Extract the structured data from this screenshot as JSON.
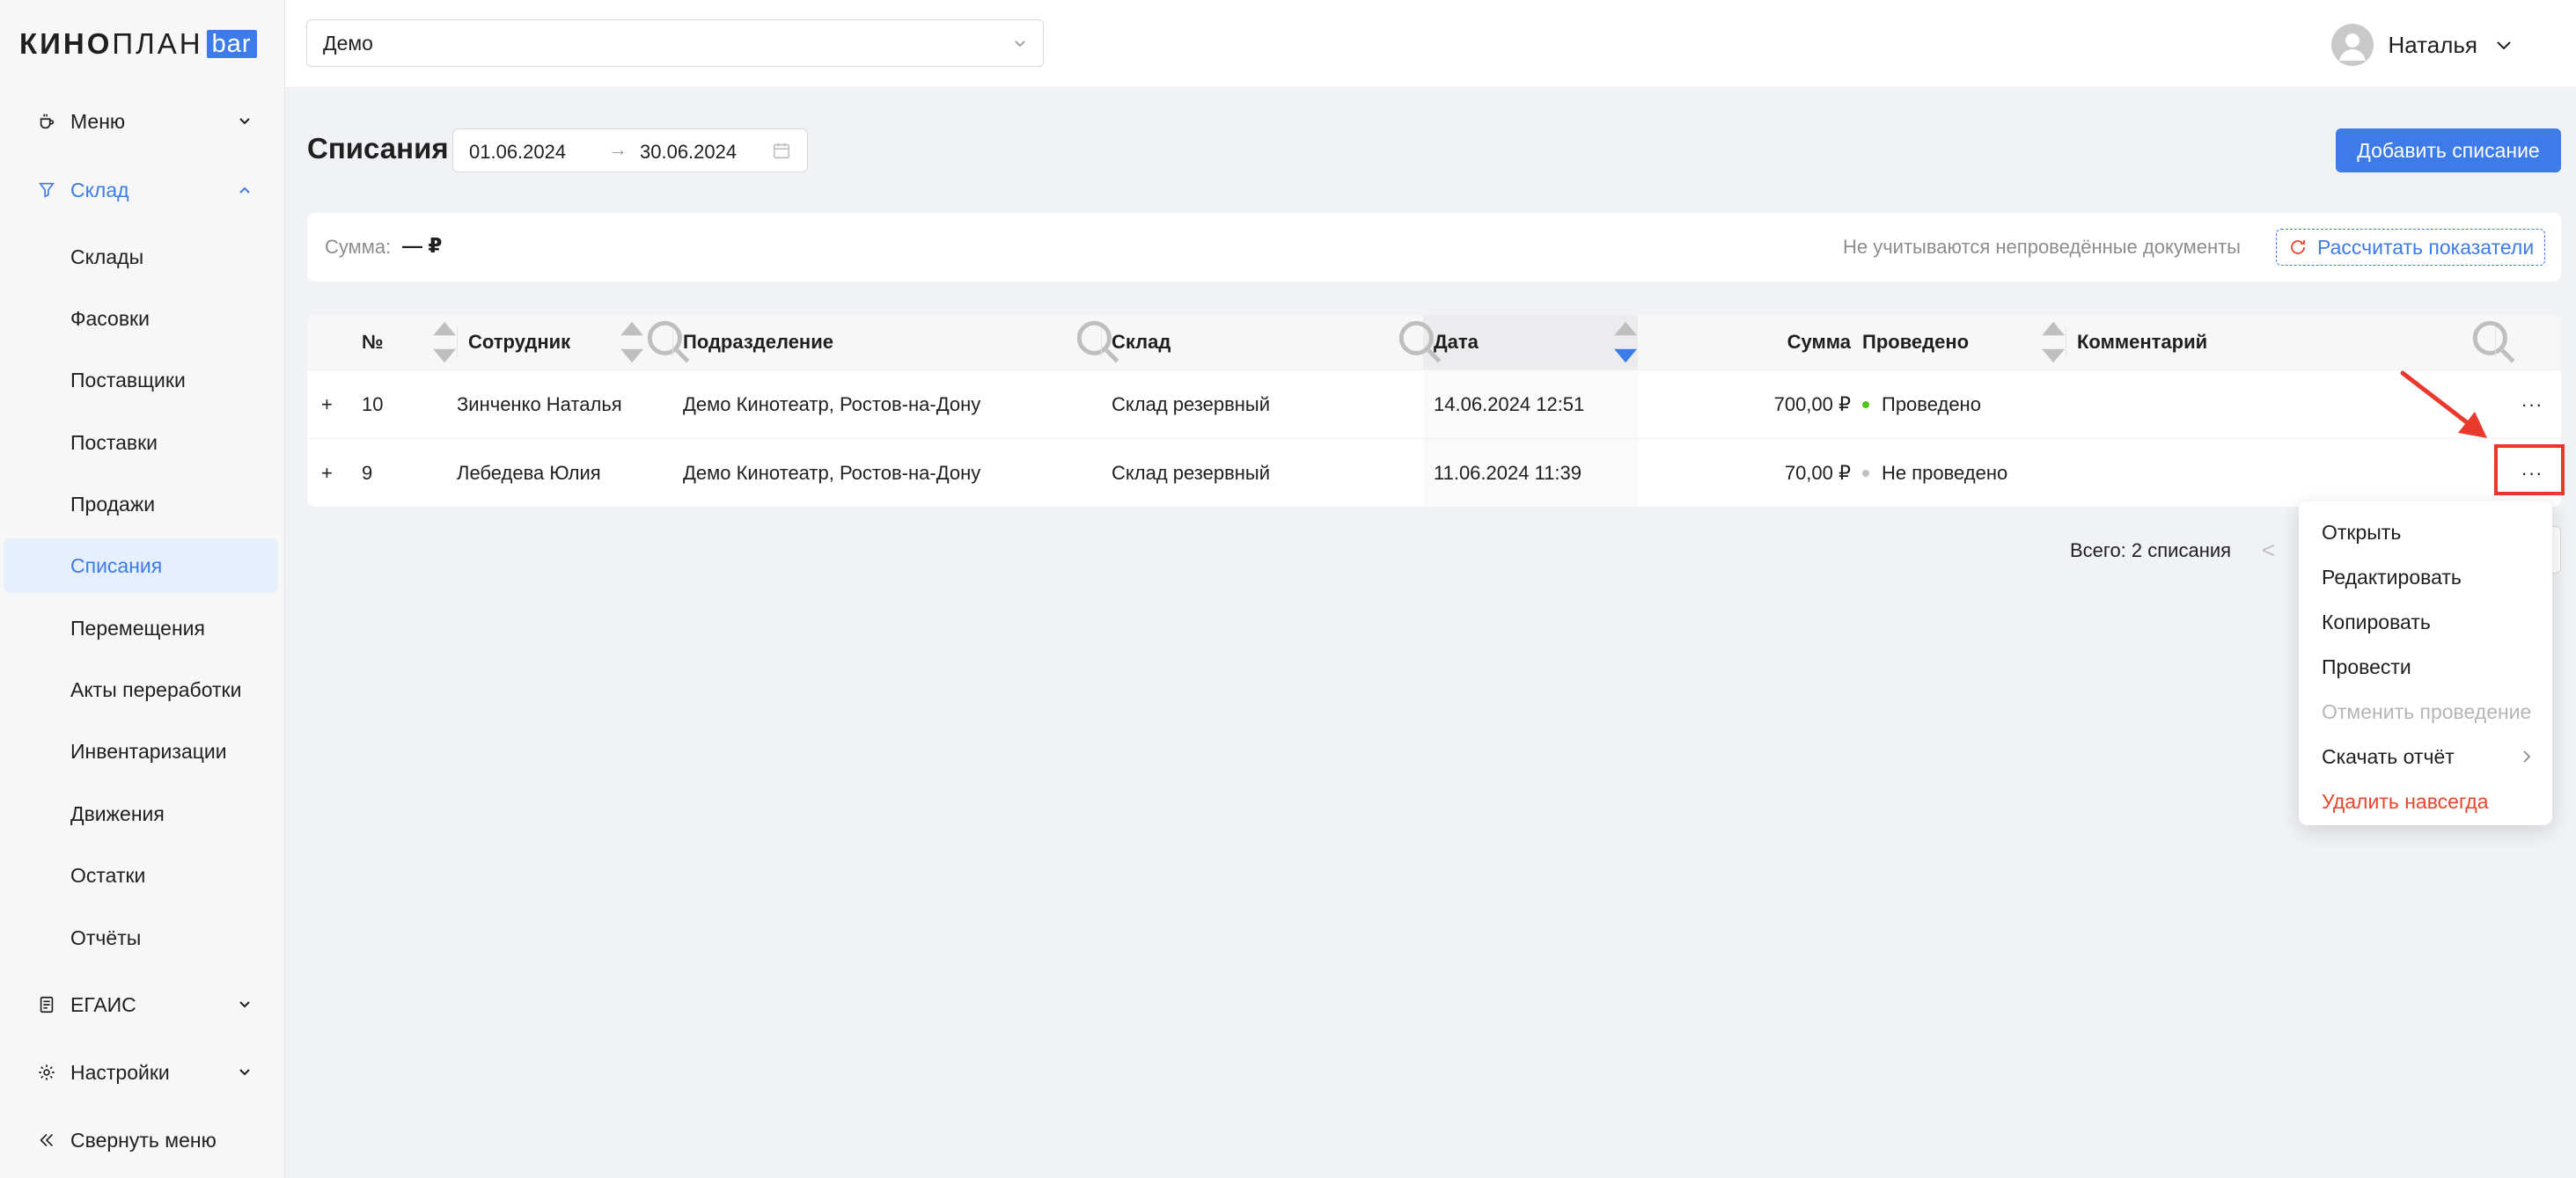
{
  "brand": {
    "part1": "КИНО",
    "part2": "ПЛАН",
    "badge": "bar"
  },
  "sidebar": {
    "groups": [
      {
        "label": "Меню",
        "icon": "coffee-cup-icon"
      },
      {
        "label": "Склад",
        "icon": "funnel-icon"
      },
      {
        "label": "ЕГАИС",
        "icon": "document-icon"
      },
      {
        "label": "Настройки",
        "icon": "gear-icon"
      }
    ],
    "sklad_items": [
      "Склады",
      "Фасовки",
      "Поставщики",
      "Поставки",
      "Продажи",
      "Списания",
      "Перемещения",
      "Акты переработки",
      "Инвентаризации",
      "Движения",
      "Остатки",
      "Отчёты"
    ],
    "collapse_label": "Свернуть меню",
    "selected_item": "Списания"
  },
  "topbar": {
    "org": "Демо",
    "user_name": "Наталья"
  },
  "page": {
    "title": "Списания",
    "date_from": "01.06.2024",
    "date_to": "30.06.2024",
    "date_sep": "→",
    "add_button": "Добавить списание"
  },
  "summary": {
    "label": "Сумма:",
    "value": "— ₽",
    "note": "Не учитываются непроведённые документы",
    "recalc_button": "Рассчитать показатели"
  },
  "table": {
    "columns": [
      "№",
      "Сотрудник",
      "Подразделение",
      "Склад",
      "Дата",
      "Сумма",
      "Проведено",
      "Комментарий"
    ],
    "rows": [
      {
        "expand": "+",
        "num": "10",
        "employee": "Зинченко Наталья",
        "division": "Демо Кинотеатр, Ростов-на-Дону",
        "warehouse": "Склад резервный",
        "date": "14.06.2024 12:51",
        "sum": "700,00 ₽",
        "status": "Проведено",
        "status_color": "#52c41a",
        "comment": "",
        "more": "···"
      },
      {
        "expand": "+",
        "num": "9",
        "employee": "Лебедева Юлия",
        "division": "Демо Кинотеатр, Ростов-на-Дону",
        "warehouse": "Склад резервный",
        "date": "11.06.2024 11:39",
        "sum": "70,00 ₽",
        "status": "Не проведено",
        "status_color": "#bfbfbf",
        "comment": "",
        "more": "···"
      }
    ]
  },
  "pagination": {
    "total": "Всего: 2 списания",
    "prev": "<"
  },
  "context_menu": {
    "items": [
      {
        "label": "Открыть"
      },
      {
        "label": "Редактировать"
      },
      {
        "label": "Копировать"
      },
      {
        "label": "Провести"
      },
      {
        "label": "Отменить проведение"
      },
      {
        "label": "Скачать отчёт"
      },
      {
        "label": "Удалить навсегда"
      }
    ]
  },
  "colors": {
    "accent": "#3d7be8",
    "danger": "#e8462c",
    "annotation": "#e8392c"
  }
}
